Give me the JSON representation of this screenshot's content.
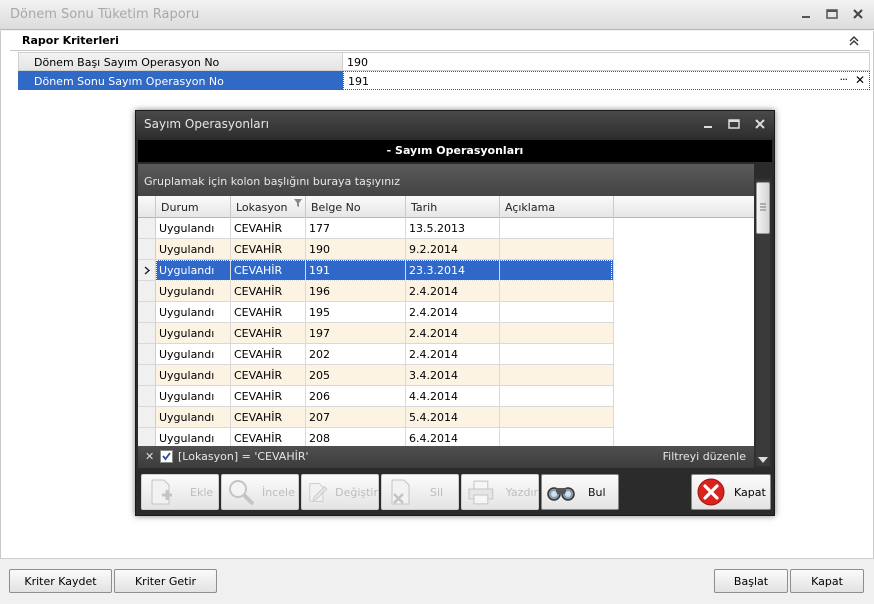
{
  "window": {
    "title": "Dönem Sonu Tüketim Raporu"
  },
  "criteria": {
    "title": "Rapor Kriterleri",
    "rows": [
      {
        "label": "Dönem Başı Sayım Operasyon No",
        "value": "190"
      },
      {
        "label": "Dönem Sonu Sayım Operasyon No",
        "value": "191"
      }
    ],
    "ellipsis": "···",
    "clear": "✕"
  },
  "dialog": {
    "title": "Sayım Operasyonları",
    "header": "- Sayım Operasyonları",
    "group_panel_text": "Gruplamak için kolon başlığını buraya taşıyınız",
    "columns": [
      "Durum",
      "Lokasyon",
      "Belge No",
      "Tarih",
      "Açıklama"
    ],
    "rows": [
      {
        "durum": "Uygulandı",
        "lokasyon": "CEVAHİR",
        "belge_no": "177",
        "tarih": "13.5.2013",
        "aciklama": ""
      },
      {
        "durum": "Uygulandı",
        "lokasyon": "CEVAHİR",
        "belge_no": "190",
        "tarih": "9.2.2014",
        "aciklama": ""
      },
      {
        "durum": "Uygulandı",
        "lokasyon": "CEVAHİR",
        "belge_no": "191",
        "tarih": "23.3.2014",
        "aciklama": ""
      },
      {
        "durum": "Uygulandı",
        "lokasyon": "CEVAHİR",
        "belge_no": "196",
        "tarih": "2.4.2014",
        "aciklama": ""
      },
      {
        "durum": "Uygulandı",
        "lokasyon": "CEVAHİR",
        "belge_no": "195",
        "tarih": "2.4.2014",
        "aciklama": ""
      },
      {
        "durum": "Uygulandı",
        "lokasyon": "CEVAHİR",
        "belge_no": "197",
        "tarih": "2.4.2014",
        "aciklama": ""
      },
      {
        "durum": "Uygulandı",
        "lokasyon": "CEVAHİR",
        "belge_no": "202",
        "tarih": "2.4.2014",
        "aciklama": ""
      },
      {
        "durum": "Uygulandı",
        "lokasyon": "CEVAHİR",
        "belge_no": "205",
        "tarih": "3.4.2014",
        "aciklama": ""
      },
      {
        "durum": "Uygulandı",
        "lokasyon": "CEVAHİR",
        "belge_no": "206",
        "tarih": "4.4.2014",
        "aciklama": ""
      },
      {
        "durum": "Uygulandı",
        "lokasyon": "CEVAHİR",
        "belge_no": "207",
        "tarih": "5.4.2014",
        "aciklama": ""
      },
      {
        "durum": "Uygulandı",
        "lokasyon": "CEVAHİR",
        "belge_no": "208",
        "tarih": "6.4.2014",
        "aciklama": ""
      }
    ],
    "selected_row": 2,
    "filter_text": "[Lokasyon] = 'CEVAHİR'",
    "filter_edit": "Filtreyi düzenle",
    "filter_close": "✕",
    "toolbar": {
      "ekle": "Ekle",
      "incele": "İncele",
      "degistir": "Değiştir",
      "sil": "Sil",
      "yazdir": "Yazdır",
      "bul": "Bul",
      "kapat": "Kapat"
    }
  },
  "bottom": {
    "kriter_kaydet": "Kriter Kaydet",
    "kriter_getir": "Kriter Getir",
    "baslat": "Başlat",
    "kapat": "Kapat"
  },
  "colors": {
    "selection": "#2f68c9",
    "alt_row": "#fdf3e3",
    "dialog_bg": "#2b2b2b"
  }
}
